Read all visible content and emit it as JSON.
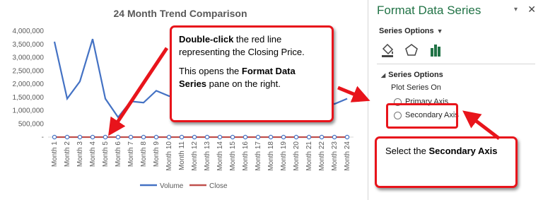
{
  "chart": {
    "title": "24 Month Trend Comparison",
    "legend": [
      "Volume",
      "Close"
    ]
  },
  "chart_data": {
    "type": "line",
    "title": "24 Month Trend Comparison",
    "categories": [
      "Month 1",
      "Month 2",
      "Month 3",
      "Month 4",
      "Month 5",
      "Month 6",
      "Month 7",
      "Month 8",
      "Month 9",
      "Month 10",
      "Month 11",
      "Month 12",
      "Month 13",
      "Month 14",
      "Month 15",
      "Month 16",
      "Month 17",
      "Month 18",
      "Month 19",
      "Month 20",
      "Month 21",
      "Month 22",
      "Month 23",
      "Month 24"
    ],
    "ylim": [
      0,
      4000000
    ],
    "y_ticks": [
      "4,000,000",
      "3,500,000",
      "3,000,000",
      "2,500,000",
      "2,000,000",
      "1,500,000",
      "1,000,000",
      "500,000",
      "-"
    ],
    "series": [
      {
        "name": "Volume",
        "color": "#4472c4",
        "values": [
          3600000,
          1450000,
          2100000,
          3700000,
          1450000,
          750000,
          1350000,
          1300000,
          1750000,
          1550000,
          1500000,
          1400000,
          1500000,
          1500000,
          1500000,
          1500000,
          1500000,
          1500000,
          1500000,
          1500000,
          1500000,
          1450000,
          1250000,
          1450000
        ]
      },
      {
        "name": "Close",
        "color": "#c0504d",
        "values": [
          30,
          30,
          30,
          30,
          30,
          30,
          30,
          30,
          30,
          30,
          30,
          30,
          30,
          30,
          30,
          30,
          30,
          30,
          30,
          30,
          30,
          30,
          30,
          30
        ]
      }
    ],
    "legend_position": "bottom",
    "grid": false
  },
  "pane": {
    "title": "Format Data Series",
    "dropdown_icon": "▾",
    "close_icon": "✕",
    "tab_label": "Series Options",
    "section_label": "Series Options",
    "plot_on_label": "Plot Series On",
    "primary_axis_label": "Primary Axis",
    "secondary_axis_label": "Secondary Axis",
    "icons": [
      "paint-bucket-icon",
      "pentagon-icon",
      "bar-chart-icon"
    ],
    "accent_color": "#217346"
  },
  "callouts": {
    "top_bold_1": "Double-click",
    "top_text_1": " the red line representing the Closing Price.",
    "top_text_2": "This opens the ",
    "top_bold_2": "Format Data Series",
    "top_text_3": " pane on the right.",
    "secondary_text": "Select the ",
    "secondary_bold": "Secondary Axis",
    "border_color": "#e8141b"
  }
}
